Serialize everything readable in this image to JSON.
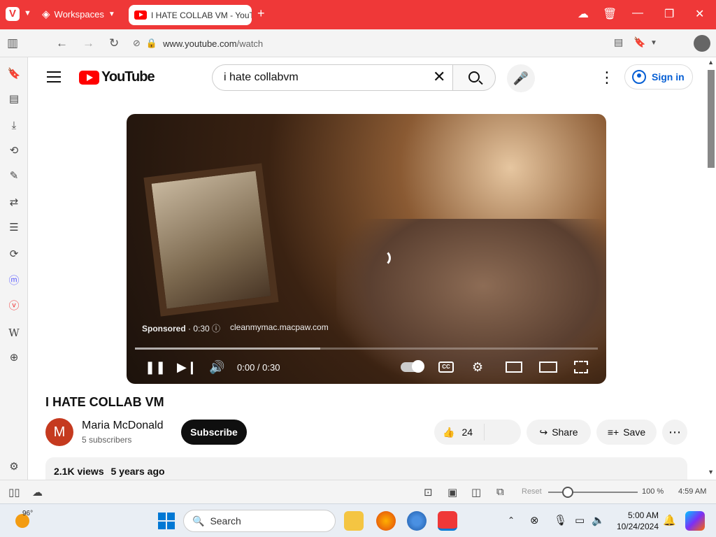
{
  "browser": {
    "workspaces_label": "Workspaces",
    "tab_title": "I HATE COLLAB VM - YouTube",
    "url_host": "www.youtube.com",
    "url_path": "/watch"
  },
  "youtube": {
    "logo_text": "YouTube",
    "search_value": "i hate collabvm",
    "sign_in_label": "Sign in"
  },
  "player": {
    "sponsored_label": "Sponsored",
    "ad_duration": "0:30",
    "ad_url": "cleanmymac.macpaw.com",
    "time_display": "0:00 / 0:30",
    "progress_fraction": 0.4,
    "cc_label": "CC"
  },
  "video": {
    "title": "I HATE COLLAB VM",
    "channel_initial": "M",
    "channel_name": "Maria McDonald",
    "subscribers": "5 subscribers",
    "subscribe_label": "Subscribe",
    "like_count": "24",
    "share_label": "Share",
    "save_label": "Save",
    "views": "2.1K views",
    "age": "5 years ago"
  },
  "statusbar": {
    "reset_label": "Reset",
    "zoom": "100 %",
    "clock": "4:59 AM"
  },
  "taskbar": {
    "temperature": "96°",
    "search_placeholder": "Search",
    "time": "5:00 AM",
    "date": "10/24/2024"
  },
  "colors": {
    "vivaldi_red": "#ef3838",
    "youtube_red": "#ff0000",
    "link_blue": "#065fd4"
  }
}
